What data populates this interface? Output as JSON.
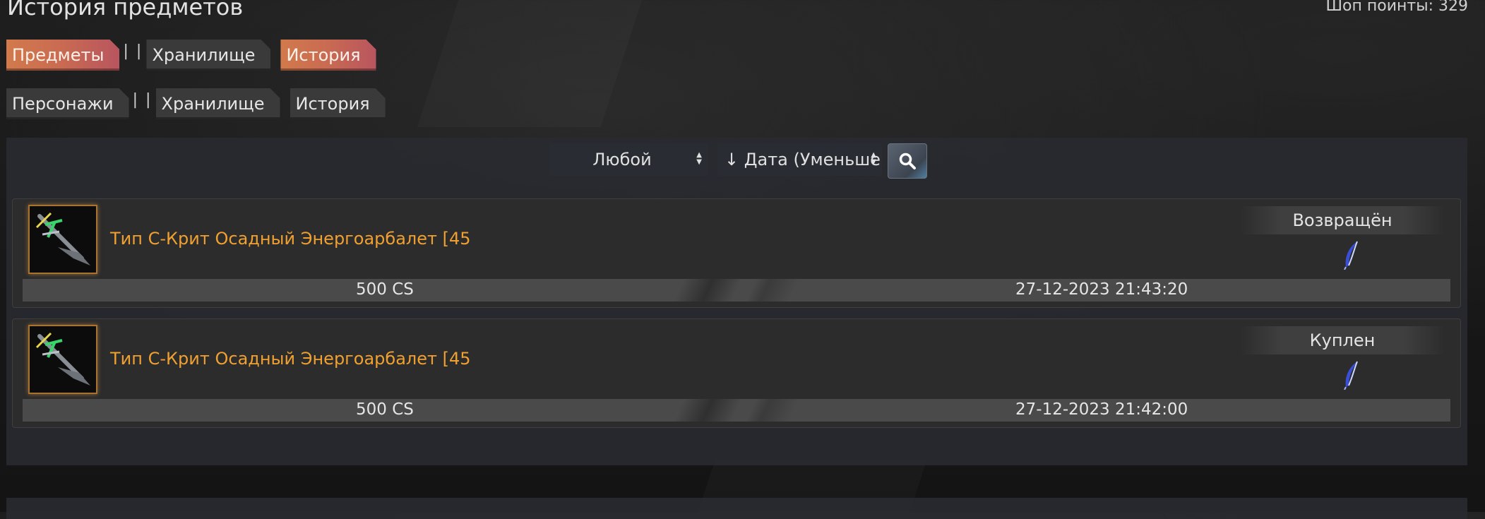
{
  "header": {
    "title": "История предметов",
    "shop_points": "Шоп поинты: 329"
  },
  "tabs_row1": {
    "items": "Предметы",
    "separator": "| |",
    "storage": "Хранилище",
    "history": "История"
  },
  "tabs_row2": {
    "characters": "Персонажи",
    "separator": "| |",
    "storage": "Хранилище",
    "history": "История"
  },
  "filters": {
    "type_selected": "Любой",
    "sort_selected": "↓ Дата (Уменьшен"
  },
  "history": [
    {
      "name": "Тип С-Крит Осадный Энергоарбалет [45",
      "status": "Возвращён",
      "price": "500 CS",
      "date": "27-12-2023 21:43:20"
    },
    {
      "name": "Тип С-Крит Осадный Энергоарбалет [45",
      "status": "Куплен",
      "price": "500 CS",
      "date": "27-12-2023 21:42:00"
    }
  ],
  "colors": {
    "active_tab": "#d27a4c",
    "item_name": "#f0a030",
    "panel": "#282a30"
  },
  "icons": {
    "search": "search-icon",
    "item": "crossbow-item-icon",
    "currency": "feather-currency-icon"
  }
}
